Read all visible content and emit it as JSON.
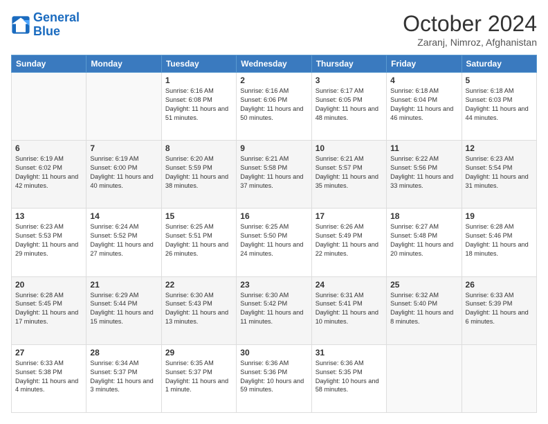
{
  "header": {
    "logo_line1": "General",
    "logo_line2": "Blue",
    "title": "October 2024",
    "subtitle": "Zaranj, Nimroz, Afghanistan"
  },
  "columns": [
    "Sunday",
    "Monday",
    "Tuesday",
    "Wednesday",
    "Thursday",
    "Friday",
    "Saturday"
  ],
  "rows": [
    [
      {
        "day": "",
        "info": ""
      },
      {
        "day": "",
        "info": ""
      },
      {
        "day": "1",
        "info": "Sunrise: 6:16 AM\nSunset: 6:08 PM\nDaylight: 11 hours and 51 minutes."
      },
      {
        "day": "2",
        "info": "Sunrise: 6:16 AM\nSunset: 6:06 PM\nDaylight: 11 hours and 50 minutes."
      },
      {
        "day": "3",
        "info": "Sunrise: 6:17 AM\nSunset: 6:05 PM\nDaylight: 11 hours and 48 minutes."
      },
      {
        "day": "4",
        "info": "Sunrise: 6:18 AM\nSunset: 6:04 PM\nDaylight: 11 hours and 46 minutes."
      },
      {
        "day": "5",
        "info": "Sunrise: 6:18 AM\nSunset: 6:03 PM\nDaylight: 11 hours and 44 minutes."
      }
    ],
    [
      {
        "day": "6",
        "info": "Sunrise: 6:19 AM\nSunset: 6:02 PM\nDaylight: 11 hours and 42 minutes."
      },
      {
        "day": "7",
        "info": "Sunrise: 6:19 AM\nSunset: 6:00 PM\nDaylight: 11 hours and 40 minutes."
      },
      {
        "day": "8",
        "info": "Sunrise: 6:20 AM\nSunset: 5:59 PM\nDaylight: 11 hours and 38 minutes."
      },
      {
        "day": "9",
        "info": "Sunrise: 6:21 AM\nSunset: 5:58 PM\nDaylight: 11 hours and 37 minutes."
      },
      {
        "day": "10",
        "info": "Sunrise: 6:21 AM\nSunset: 5:57 PM\nDaylight: 11 hours and 35 minutes."
      },
      {
        "day": "11",
        "info": "Sunrise: 6:22 AM\nSunset: 5:56 PM\nDaylight: 11 hours and 33 minutes."
      },
      {
        "day": "12",
        "info": "Sunrise: 6:23 AM\nSunset: 5:54 PM\nDaylight: 11 hours and 31 minutes."
      }
    ],
    [
      {
        "day": "13",
        "info": "Sunrise: 6:23 AM\nSunset: 5:53 PM\nDaylight: 11 hours and 29 minutes."
      },
      {
        "day": "14",
        "info": "Sunrise: 6:24 AM\nSunset: 5:52 PM\nDaylight: 11 hours and 27 minutes."
      },
      {
        "day": "15",
        "info": "Sunrise: 6:25 AM\nSunset: 5:51 PM\nDaylight: 11 hours and 26 minutes."
      },
      {
        "day": "16",
        "info": "Sunrise: 6:25 AM\nSunset: 5:50 PM\nDaylight: 11 hours and 24 minutes."
      },
      {
        "day": "17",
        "info": "Sunrise: 6:26 AM\nSunset: 5:49 PM\nDaylight: 11 hours and 22 minutes."
      },
      {
        "day": "18",
        "info": "Sunrise: 6:27 AM\nSunset: 5:48 PM\nDaylight: 11 hours and 20 minutes."
      },
      {
        "day": "19",
        "info": "Sunrise: 6:28 AM\nSunset: 5:46 PM\nDaylight: 11 hours and 18 minutes."
      }
    ],
    [
      {
        "day": "20",
        "info": "Sunrise: 6:28 AM\nSunset: 5:45 PM\nDaylight: 11 hours and 17 minutes."
      },
      {
        "day": "21",
        "info": "Sunrise: 6:29 AM\nSunset: 5:44 PM\nDaylight: 11 hours and 15 minutes."
      },
      {
        "day": "22",
        "info": "Sunrise: 6:30 AM\nSunset: 5:43 PM\nDaylight: 11 hours and 13 minutes."
      },
      {
        "day": "23",
        "info": "Sunrise: 6:30 AM\nSunset: 5:42 PM\nDaylight: 11 hours and 11 minutes."
      },
      {
        "day": "24",
        "info": "Sunrise: 6:31 AM\nSunset: 5:41 PM\nDaylight: 11 hours and 10 minutes."
      },
      {
        "day": "25",
        "info": "Sunrise: 6:32 AM\nSunset: 5:40 PM\nDaylight: 11 hours and 8 minutes."
      },
      {
        "day": "26",
        "info": "Sunrise: 6:33 AM\nSunset: 5:39 PM\nDaylight: 11 hours and 6 minutes."
      }
    ],
    [
      {
        "day": "27",
        "info": "Sunrise: 6:33 AM\nSunset: 5:38 PM\nDaylight: 11 hours and 4 minutes."
      },
      {
        "day": "28",
        "info": "Sunrise: 6:34 AM\nSunset: 5:37 PM\nDaylight: 11 hours and 3 minutes."
      },
      {
        "day": "29",
        "info": "Sunrise: 6:35 AM\nSunset: 5:37 PM\nDaylight: 11 hours and 1 minute."
      },
      {
        "day": "30",
        "info": "Sunrise: 6:36 AM\nSunset: 5:36 PM\nDaylight: 10 hours and 59 minutes."
      },
      {
        "day": "31",
        "info": "Sunrise: 6:36 AM\nSunset: 5:35 PM\nDaylight: 10 hours and 58 minutes."
      },
      {
        "day": "",
        "info": ""
      },
      {
        "day": "",
        "info": ""
      }
    ]
  ]
}
